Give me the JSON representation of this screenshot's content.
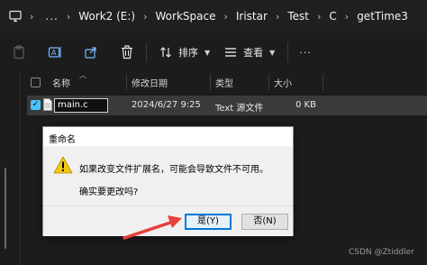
{
  "breadcrumbs": [
    "Work2 (E:)",
    "WorkSpace",
    "Iristar",
    "Test",
    "C",
    "getTime3"
  ],
  "more_glyph": "...",
  "separator": "›",
  "toolbar": {
    "sort_label": "排序",
    "view_label": "查看",
    "more_label": "···"
  },
  "columns": {
    "name": "名称",
    "modified": "修改日期",
    "type": "类型",
    "size": "大小"
  },
  "file_row": {
    "checked_glyph": "✓",
    "name": "main.c",
    "modified": "2024/6/27 9:25",
    "type": "Text 源文件",
    "size": "0 KB"
  },
  "dialog": {
    "title": "重命名",
    "message": "如果改变文件扩展名，可能会导致文件不可用。",
    "question": "确实要更改吗?",
    "yes_label": "是(Y)",
    "no_label": "否(N)"
  },
  "watermark": "CSDN @Ztiddler",
  "colors": {
    "accent": "#4cc2ff",
    "dialog_bg": "#f0f0f0",
    "arrow": "#e8403a",
    "warning": "#f2c811"
  }
}
